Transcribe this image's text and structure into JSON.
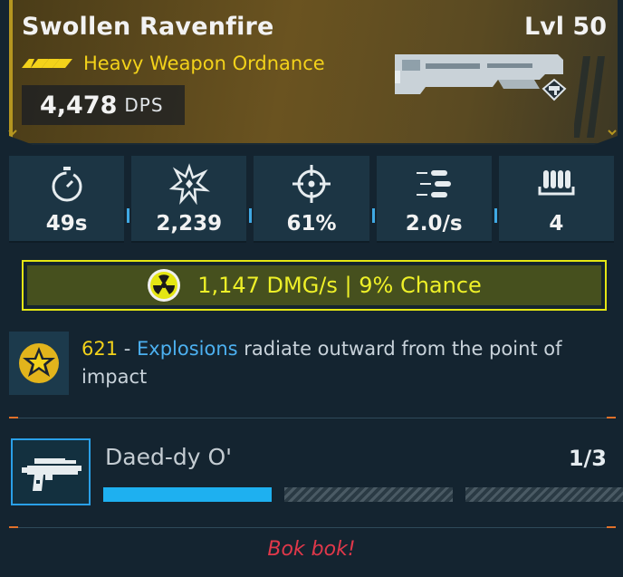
{
  "item": {
    "name": "Swollen Ravenfire",
    "level": "Lvl 50",
    "rarity_icon": "rarity-chevrons-icon",
    "weapon_type": "Heavy Weapon Ordnance",
    "dps_value": "4,478",
    "dps_unit": "DPS"
  },
  "stats": [
    {
      "icon": "stopwatch-icon",
      "value": "49s"
    },
    {
      "icon": "impact-burst-icon",
      "value": "2,239"
    },
    {
      "icon": "crosshair-icon",
      "value": "61%"
    },
    {
      "icon": "bullets-fire-rate-icon",
      "value": "2.0/s"
    },
    {
      "icon": "magazine-icon",
      "value": "4"
    }
  ],
  "elemental": {
    "icon": "radiation-icon",
    "text": "1,147 DMG/s | 9% Chance",
    "color": "#eef028"
  },
  "perk": {
    "icon": "explosion-star-icon",
    "number": "621",
    "dash": " - ",
    "keyword": "Explosions",
    "rest": " radiate outward from the point of impact"
  },
  "mission": {
    "icon": "pistol-icon",
    "title": "Daed-dy O'",
    "count": "1/3",
    "progress_segments": 3,
    "progress_filled": 1
  },
  "flavor_text": "Bok bok!",
  "colors": {
    "rarity": "#f3d21a",
    "accent_blue": "#1eb0f0",
    "flavor": "#e0384a"
  }
}
